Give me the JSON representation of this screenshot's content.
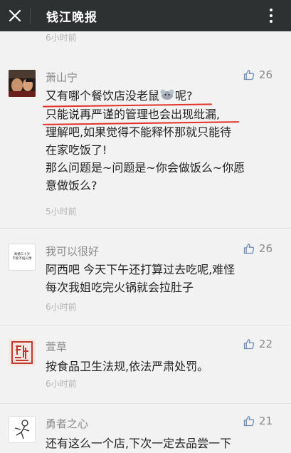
{
  "header": {
    "title": "钱江晚报"
  },
  "top_time": "6小时前",
  "comments": [
    {
      "name": "萧山宁",
      "likes": "26",
      "lines": [
        "又有哪个餐饮店没老鼠",
        "呢?",
        "只能说再严谨的管理也会出现纰漏,",
        "理解吧,如果觉得不能释怀那就只能待",
        "在家吃饭了!",
        "那么问题是~问题是~你会做饭么~你愿",
        "意做饭么?"
      ],
      "time": "5小时前"
    },
    {
      "name": "我可以很好",
      "likes": "26",
      "avatar_text": [
        "离婚三十岁",
        "不能不插头像"
      ],
      "lines": [
        "阿西吧 今天下午还打算过去吃呢,难怪",
        "每次我姐吃完火锅就会拉肚子"
      ],
      "time": "6小时前"
    },
    {
      "name": "萱草",
      "likes": "22",
      "lines": [
        "按食品卫生法规,依法严肃处罚。"
      ],
      "time": "6小时前"
    },
    {
      "name": "勇者之心",
      "likes": "21",
      "lines": [
        "还有这么一个店,下次一定去品尝一下"
      ]
    }
  ],
  "colors": {
    "topbar": "#2e3132",
    "underline": "#e2332a",
    "meta": "#8a8a8a"
  }
}
